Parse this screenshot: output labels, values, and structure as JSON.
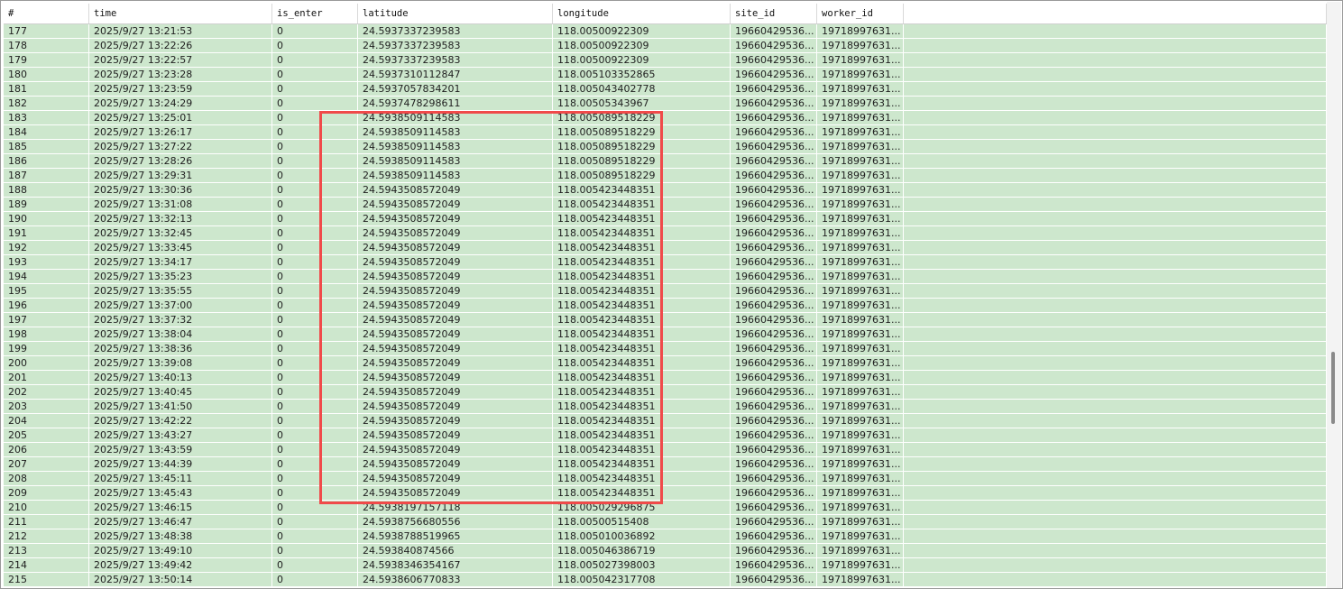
{
  "table": {
    "columns": [
      "#",
      "time",
      "is_enter",
      "latitude",
      "longitude",
      "site_id",
      "worker_id",
      ""
    ],
    "rows": [
      [
        "177",
        "2025/9/27 13:21:53",
        "0",
        "24.5937337239583",
        "118.00500922309",
        "19660429536...",
        "19718997631...",
        ""
      ],
      [
        "178",
        "2025/9/27 13:22:26",
        "0",
        "24.5937337239583",
        "118.00500922309",
        "19660429536...",
        "19718997631...",
        ""
      ],
      [
        "179",
        "2025/9/27 13:22:57",
        "0",
        "24.5937337239583",
        "118.00500922309",
        "19660429536...",
        "19718997631...",
        ""
      ],
      [
        "180",
        "2025/9/27 13:23:28",
        "0",
        "24.5937310112847",
        "118.005103352865",
        "19660429536...",
        "19718997631...",
        ""
      ],
      [
        "181",
        "2025/9/27 13:23:59",
        "0",
        "24.5937057834201",
        "118.005043402778",
        "19660429536...",
        "19718997631...",
        ""
      ],
      [
        "182",
        "2025/9/27 13:24:29",
        "0",
        "24.5937478298611",
        "118.00505343967",
        "19660429536...",
        "19718997631...",
        ""
      ],
      [
        "183",
        "2025/9/27 13:25:01",
        "0",
        "24.5938509114583",
        "118.005089518229",
        "19660429536...",
        "19718997631...",
        ""
      ],
      [
        "184",
        "2025/9/27 13:26:17",
        "0",
        "24.5938509114583",
        "118.005089518229",
        "19660429536...",
        "19718997631...",
        ""
      ],
      [
        "185",
        "2025/9/27 13:27:22",
        "0",
        "24.5938509114583",
        "118.005089518229",
        "19660429536...",
        "19718997631...",
        ""
      ],
      [
        "186",
        "2025/9/27 13:28:26",
        "0",
        "24.5938509114583",
        "118.005089518229",
        "19660429536...",
        "19718997631...",
        ""
      ],
      [
        "187",
        "2025/9/27 13:29:31",
        "0",
        "24.5938509114583",
        "118.005089518229",
        "19660429536...",
        "19718997631...",
        ""
      ],
      [
        "188",
        "2025/9/27 13:30:36",
        "0",
        "24.5943508572049",
        "118.005423448351",
        "19660429536...",
        "19718997631...",
        ""
      ],
      [
        "189",
        "2025/9/27 13:31:08",
        "0",
        "24.5943508572049",
        "118.005423448351",
        "19660429536...",
        "19718997631...",
        ""
      ],
      [
        "190",
        "2025/9/27 13:32:13",
        "0",
        "24.5943508572049",
        "118.005423448351",
        "19660429536...",
        "19718997631...",
        ""
      ],
      [
        "191",
        "2025/9/27 13:32:45",
        "0",
        "24.5943508572049",
        "118.005423448351",
        "19660429536...",
        "19718997631...",
        ""
      ],
      [
        "192",
        "2025/9/27 13:33:45",
        "0",
        "24.5943508572049",
        "118.005423448351",
        "19660429536...",
        "19718997631...",
        ""
      ],
      [
        "193",
        "2025/9/27 13:34:17",
        "0",
        "24.5943508572049",
        "118.005423448351",
        "19660429536...",
        "19718997631...",
        ""
      ],
      [
        "194",
        "2025/9/27 13:35:23",
        "0",
        "24.5943508572049",
        "118.005423448351",
        "19660429536...",
        "19718997631...",
        ""
      ],
      [
        "195",
        "2025/9/27 13:35:55",
        "0",
        "24.5943508572049",
        "118.005423448351",
        "19660429536...",
        "19718997631...",
        ""
      ],
      [
        "196",
        "2025/9/27 13:37:00",
        "0",
        "24.5943508572049",
        "118.005423448351",
        "19660429536...",
        "19718997631...",
        ""
      ],
      [
        "197",
        "2025/9/27 13:37:32",
        "0",
        "24.5943508572049",
        "118.005423448351",
        "19660429536...",
        "19718997631...",
        ""
      ],
      [
        "198",
        "2025/9/27 13:38:04",
        "0",
        "24.5943508572049",
        "118.005423448351",
        "19660429536...",
        "19718997631...",
        ""
      ],
      [
        "199",
        "2025/9/27 13:38:36",
        "0",
        "24.5943508572049",
        "118.005423448351",
        "19660429536...",
        "19718997631...",
        ""
      ],
      [
        "200",
        "2025/9/27 13:39:08",
        "0",
        "24.5943508572049",
        "118.005423448351",
        "19660429536...",
        "19718997631...",
        ""
      ],
      [
        "201",
        "2025/9/27 13:40:13",
        "0",
        "24.5943508572049",
        "118.005423448351",
        "19660429536...",
        "19718997631...",
        ""
      ],
      [
        "202",
        "2025/9/27 13:40:45",
        "0",
        "24.5943508572049",
        "118.005423448351",
        "19660429536...",
        "19718997631...",
        ""
      ],
      [
        "203",
        "2025/9/27 13:41:50",
        "0",
        "24.5943508572049",
        "118.005423448351",
        "19660429536...",
        "19718997631...",
        ""
      ],
      [
        "204",
        "2025/9/27 13:42:22",
        "0",
        "24.5943508572049",
        "118.005423448351",
        "19660429536...",
        "19718997631...",
        ""
      ],
      [
        "205",
        "2025/9/27 13:43:27",
        "0",
        "24.5943508572049",
        "118.005423448351",
        "19660429536...",
        "19718997631...",
        ""
      ],
      [
        "206",
        "2025/9/27 13:43:59",
        "0",
        "24.5943508572049",
        "118.005423448351",
        "19660429536...",
        "19718997631...",
        ""
      ],
      [
        "207",
        "2025/9/27 13:44:39",
        "0",
        "24.5943508572049",
        "118.005423448351",
        "19660429536...",
        "19718997631...",
        ""
      ],
      [
        "208",
        "2025/9/27 13:45:11",
        "0",
        "24.5943508572049",
        "118.005423448351",
        "19660429536...",
        "19718997631...",
        ""
      ],
      [
        "209",
        "2025/9/27 13:45:43",
        "0",
        "24.5943508572049",
        "118.005423448351",
        "19660429536...",
        "19718997631...",
        ""
      ],
      [
        "210",
        "2025/9/27 13:46:15",
        "0",
        "24.5938197157118",
        "118.005029296875",
        "19660429536...",
        "19718997631...",
        ""
      ],
      [
        "211",
        "2025/9/27 13:46:47",
        "0",
        "24.5938756680556",
        "118.00500515408",
        "19660429536...",
        "19718997631...",
        ""
      ],
      [
        "212",
        "2025/9/27 13:48:38",
        "0",
        "24.5938788519965",
        "118.005010036892",
        "19660429536...",
        "19718997631...",
        ""
      ],
      [
        "213",
        "2025/9/27 13:49:10",
        "0",
        "24.593840874566",
        "118.005046386719",
        "19660429536...",
        "19718997631...",
        ""
      ],
      [
        "214",
        "2025/9/27 13:49:42",
        "0",
        "24.5938346354167",
        "118.005027398003",
        "19660429536...",
        "19718997631...",
        ""
      ],
      [
        "215",
        "2025/9/27 13:50:14",
        "0",
        "24.5938606770833",
        "118.005042317708",
        "19660429536...",
        "19718997631...",
        ""
      ]
    ]
  },
  "colors": {
    "row_background": "#cde7cd",
    "highlight_border": "#f04a4a",
    "header_background": "#ffffff"
  }
}
